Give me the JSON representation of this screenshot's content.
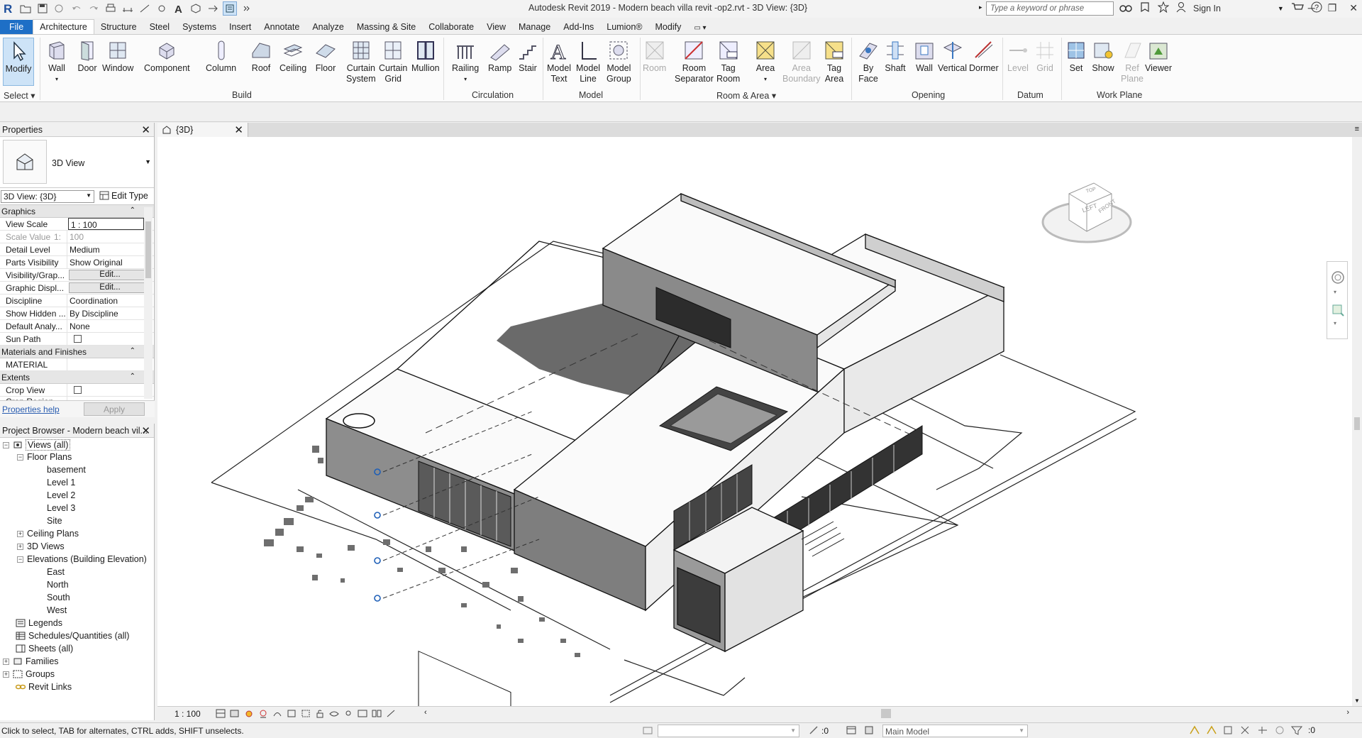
{
  "app": {
    "title": "Autodesk Revit 2019 - Modern beach villa revit -op2.rvt - 3D View: {3D}",
    "search_placeholder": "Type a keyword or phrase",
    "sign_in": "Sign In"
  },
  "tabs": [
    "File",
    "Architecture",
    "Structure",
    "Steel",
    "Systems",
    "Insert",
    "Annotate",
    "Analyze",
    "Massing & Site",
    "Collaborate",
    "View",
    "Manage",
    "Add-Ins",
    "Lumion®",
    "Modify"
  ],
  "ribbon": {
    "modify": "Modify",
    "select_group": "Select",
    "wall": "Wall",
    "door": "Door",
    "window": "Window",
    "component": "Component",
    "column": "Column",
    "roof": "Roof",
    "ceiling": "Ceiling",
    "floor": "Floor",
    "curtain_system_1": "Curtain",
    "curtain_system_2": "System",
    "curtain_grid_1": "Curtain",
    "curtain_grid_2": "Grid",
    "mullion": "Mullion",
    "build_group": "Build",
    "railing": "Railing",
    "ramp": "Ramp",
    "stair": "Stair",
    "circulation_group": "Circulation",
    "model_text_1": "Model",
    "model_text_2": "Text",
    "model_line_1": "Model",
    "model_line_2": "Line",
    "model_group_1": "Model",
    "model_group_2": "Group",
    "model_group_label": "Model",
    "room": "Room",
    "room_sep_1": "Room",
    "room_sep_2": "Separator",
    "tag_room_1": "Tag",
    "tag_room_2": "Room",
    "area": "Area",
    "area_boundary_1": "Area",
    "area_boundary_2": "Boundary",
    "tag_area_1": "Tag",
    "tag_area_2": "Area",
    "room_area_group": "Room & Area",
    "by_face_1": "By",
    "by_face_2": "Face",
    "shaft": "Shaft",
    "opening_wall": "Wall",
    "vertical": "Vertical",
    "dormer": "Dormer",
    "opening_group": "Opening",
    "level": "Level",
    "grid": "Grid",
    "datum_group": "Datum",
    "set": "Set",
    "show": "Show",
    "ref_plane_1": "Ref",
    "ref_plane_2": "Plane",
    "viewer": "Viewer",
    "work_plane_group": "Work Plane"
  },
  "properties": {
    "title": "Properties",
    "type_name": "3D View",
    "view_selector": "3D View: {3D}",
    "edit_type": "Edit Type",
    "sections": {
      "graphics": "Graphics",
      "materials": "Materials and Finishes",
      "extents": "Extents"
    },
    "rows": {
      "view_scale": {
        "k": "View Scale",
        "v": "1 : 100"
      },
      "scale_value": {
        "k": "Scale Value",
        "k2": "1:",
        "v": "100"
      },
      "detail_level": {
        "k": "Detail Level",
        "v": "Medium"
      },
      "parts_visibility": {
        "k": "Parts Visibility",
        "v": "Show Original"
      },
      "visibility": {
        "k": "Visibility/Grap...",
        "v": "Edit..."
      },
      "graphic_display": {
        "k": "Graphic Displ...",
        "v": "Edit..."
      },
      "discipline": {
        "k": "Discipline",
        "v": "Coordination"
      },
      "show_hidden": {
        "k": "Show Hidden ...",
        "v": "By Discipline"
      },
      "default_analysis": {
        "k": "Default Analy...",
        "v": "None"
      },
      "sun_path": {
        "k": "Sun Path"
      },
      "material": {
        "k": "MATERIAL"
      },
      "crop_view": {
        "k": "Crop View"
      },
      "crop_region": {
        "k": "Crop Region"
      }
    },
    "help": "Properties help",
    "apply": "Apply"
  },
  "browser": {
    "title": "Project Browser - Modern beach vil...",
    "views_all": "Views (all)",
    "floor_plans": "Floor Plans",
    "fp_items": [
      "basement",
      "Level 1",
      "Level 2",
      "Level 3",
      "Site"
    ],
    "ceiling_plans": "Ceiling Plans",
    "views_3d": "3D Views",
    "elevations": "Elevations (Building Elevation)",
    "elev_items": [
      "East",
      "North",
      "South",
      "West"
    ],
    "legends": "Legends",
    "schedules": "Schedules/Quantities (all)",
    "sheets": "Sheets (all)",
    "families": "Families",
    "groups": "Groups",
    "revit_links": "Revit Links"
  },
  "viewport": {
    "tab": "{3D}",
    "scale": "1 : 100",
    "viewcube_left": "LEFT",
    "viewcube_front": "FRONT",
    "viewcube_top": "TOP"
  },
  "statusbar": {
    "hint": "Click to select, TAB for alternates, CTRL adds, SHIFT unselects.",
    "ws_count": ":0",
    "model": "Main Model",
    "filter_count": ":0"
  },
  "colors": {
    "file_tab": "#1e6fc6",
    "modify_selected": "#cde3f7",
    "shadow": "#6e6e6e"
  }
}
